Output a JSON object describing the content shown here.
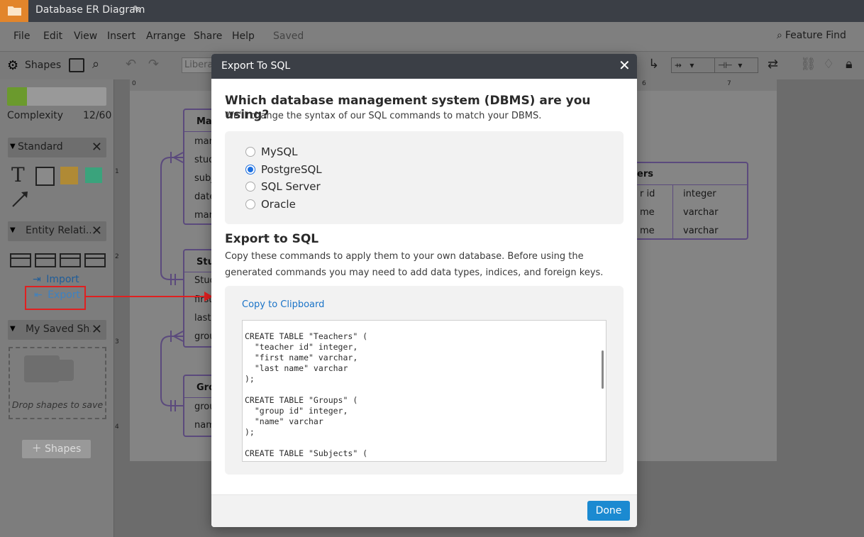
{
  "app": {
    "title": "Database ER Diagram",
    "icons": {
      "folder": "folder-icon",
      "edit": "pencil-icon"
    }
  },
  "menu": {
    "items": [
      "File",
      "Edit",
      "View",
      "Insert",
      "Arrange",
      "Share",
      "Help"
    ],
    "status": "Saved",
    "feature_find": "Feature Find"
  },
  "toolbar": {
    "shapes_label": "Shapes",
    "font_value": "Libera"
  },
  "sidebar": {
    "complexity_label": "Complexity",
    "complexity_value": "12/60",
    "complexity_fraction": 0.2,
    "standard": {
      "title": "Standard"
    },
    "entity": {
      "title": "Entity Relati...",
      "import_label": "Import",
      "export_label": "Export"
    },
    "saved": {
      "title": "My Saved Sh...",
      "drop_hint": "Drop shapes to save"
    },
    "add_shapes_label": "Shapes"
  },
  "canvas": {
    "ruler_ticks": [
      "0",
      "6",
      "7"
    ],
    "side_ticks": [
      "1",
      "2",
      "3",
      "4"
    ],
    "entities": [
      {
        "title": "Mar",
        "rows": [
          "mark",
          "stud",
          "subj",
          "date",
          "mark"
        ]
      },
      {
        "title": "Stud",
        "rows": [
          "Stud",
          "first",
          "last",
          "grou"
        ]
      },
      {
        "title": "Grou",
        "rows": [
          "grou",
          "nam"
        ]
      },
      {
        "title": "ers",
        "rows": [
          [
            "r id",
            "integer"
          ],
          [
            "me",
            "varchar"
          ],
          [
            "me",
            "varchar"
          ]
        ]
      }
    ]
  },
  "dialog": {
    "title": "Export To SQL",
    "question": "Which database management system (DBMS) are you using?",
    "question_sub": "We'll change the syntax of our SQL commands to match your DBMS.",
    "options": [
      {
        "label": "MySQL",
        "selected": false
      },
      {
        "label": "PostgreSQL",
        "selected": true
      },
      {
        "label": "SQL Server",
        "selected": false
      },
      {
        "label": "Oracle",
        "selected": false
      }
    ],
    "export_heading": "Export to SQL",
    "export_desc": "Copy these commands to apply them to your own database. Before using the generated commands you may need to add data types, indices, and foreign keys.",
    "copy_label": "Copy to Clipboard",
    "sql_code": "CREATE TABLE \"Teachers\" (\n  \"teacher id\" integer,\n  \"first name\" varchar,\n  \"last name\" varchar\n);\n\nCREATE TABLE \"Groups\" (\n  \"group id\" integer,\n  \"name\" varchar\n);\n\nCREATE TABLE \"Subjects\" (",
    "done_label": "Done"
  },
  "colors": {
    "accent": "#1b8ad1",
    "highlight": "#e02020",
    "titlebar": "#3b3f46",
    "complexity_fill": "#8dc63f"
  }
}
